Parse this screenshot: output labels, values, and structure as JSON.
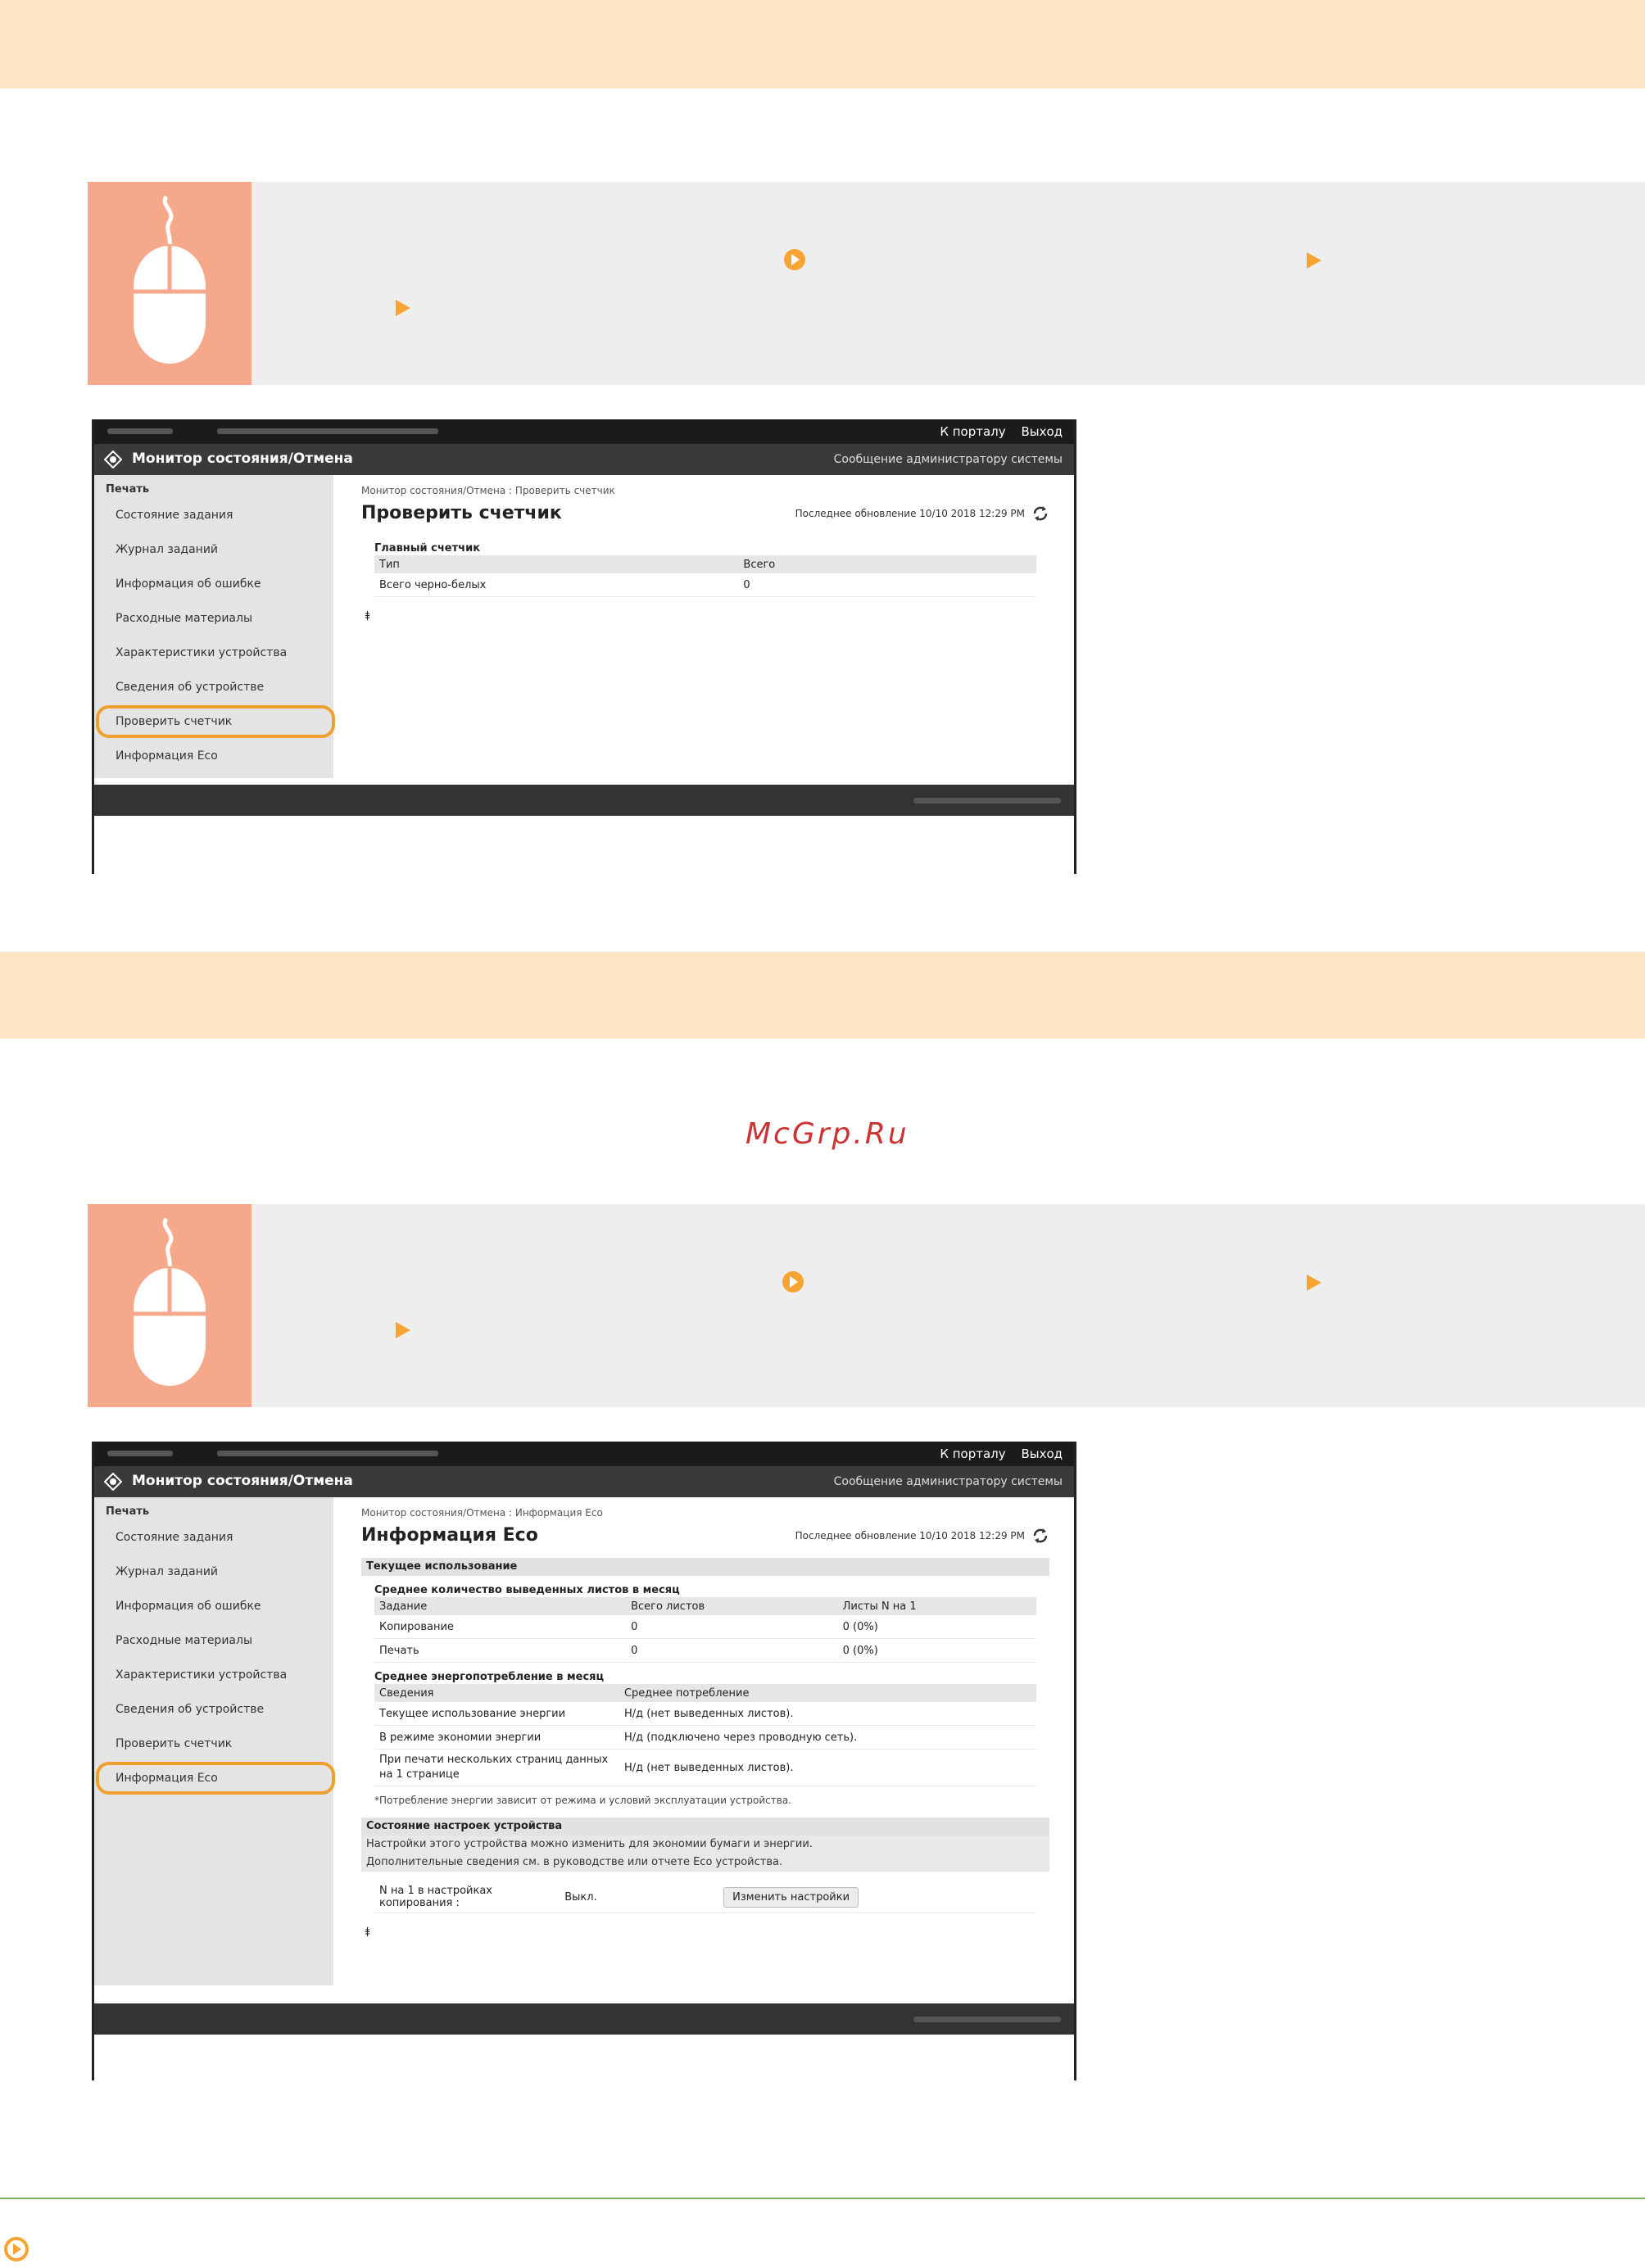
{
  "colors": {
    "header_band": "#fde5c5",
    "step_box": "#eeeeee",
    "mouse_box": "#f6a98a",
    "arrow": "#f7a433",
    "highlight": "#f0a030",
    "watermark": "#cc3333",
    "rule": "#7fb069"
  },
  "icons": [
    "mouse-icon",
    "arrow-circle-icon",
    "arrow-right-icon",
    "refresh-icon",
    "canon-logo-icon",
    "back-to-top-icon"
  ],
  "watermark": "McGrp.Ru",
  "ui": {
    "top_links": [
      "К порталу",
      "Выход"
    ],
    "app_title": "Монитор состояния/Отмена",
    "admin_msg": "Сообщение администратору системы",
    "sidebar_head": "Печать",
    "sidebar_items": [
      "Состояние задания",
      "Журнал заданий",
      "Информация об ошибке",
      "Расходные материалы",
      "Характеристики устройства",
      "Сведения об устройстве",
      "Проверить счетчик",
      "Информация Eco"
    ],
    "updated": "Последнее обновление 10/10 2018 12:29 PM"
  },
  "screen1": {
    "crumb": "Монитор состояния/Отмена : Проверить счетчик",
    "title": "Проверить счетчик",
    "section": "Главный счетчик",
    "columns": [
      "Тип",
      "Всего"
    ],
    "rows": [
      [
        "Всего черно-белых",
        "0"
      ]
    ]
  },
  "screen2": {
    "crumb": "Монитор состояния/Отмена : Информация Eco",
    "title": "Информация Eco",
    "section1": "Текущее использование",
    "sub1": "Среднее количество выведенных листов в месяц",
    "t1_columns": [
      "Задание",
      "Всего листов",
      "Листы N на 1"
    ],
    "t1_rows": [
      [
        "Копирование",
        "0",
        "0 (0%)"
      ],
      [
        "Печать",
        "0",
        "0 (0%)"
      ]
    ],
    "sub2": "Среднее энергопотребление в месяц",
    "t2_columns": [
      "Сведения",
      "Среднее потребление"
    ],
    "t2_rows": [
      [
        "Текущее использование энергии",
        "Н/д (нет выведенных листов)."
      ],
      [
        "В режиме экономии энергии",
        "Н/д (подключено через проводную сеть)."
      ],
      [
        "При печати нескольких страниц данных на 1 странице",
        "Н/д (нет выведенных листов)."
      ]
    ],
    "note": "*Потребление энергии зависит от режима и условий эксплуатации устройства.",
    "section2": "Состояние настроек устройства",
    "desc1": "Настройки этого устройства можно изменить для экономии бумаги и энергии.",
    "desc2": "Дополнительные сведения см. в руководстве или отчете Eco устройства.",
    "setting_label": "N на 1 в настройках копирования :",
    "setting_value": "Выкл.",
    "change_button": "Изменить настройки"
  }
}
